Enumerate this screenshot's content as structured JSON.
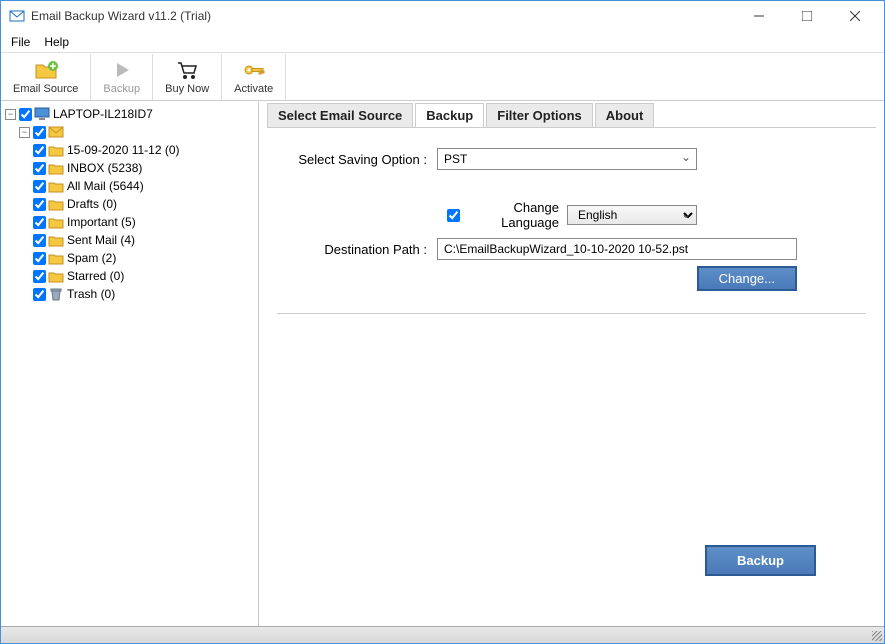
{
  "titlebar": {
    "title": "Email Backup Wizard v11.2 (Trial)"
  },
  "menu": {
    "file": "File",
    "help": "Help"
  },
  "toolbar": {
    "email_source": "Email Source",
    "backup": "Backup",
    "buy_now": "Buy Now",
    "activate": "Activate"
  },
  "tree": {
    "root": "LAPTOP-IL218ID7",
    "items": [
      "15-09-2020 11-12 (0)",
      "INBOX (5238)",
      "All Mail (5644)",
      "Drafts (0)",
      "Important (5)",
      "Sent Mail (4)",
      "Spam (2)",
      "Starred (0)",
      "Trash (0)"
    ]
  },
  "tabs": {
    "select_source": "Select Email Source",
    "backup": "Backup",
    "filter": "Filter Options",
    "about": "About"
  },
  "form": {
    "saving_option_label": "Select Saving Option :",
    "saving_option_value": "PST",
    "change_language_label": "Change Language",
    "language_value": "English",
    "destination_label": "Destination Path :",
    "destination_value": "C:\\EmailBackupWizard_10-10-2020 10-52.pst",
    "change_button": "Change...",
    "backup_button": "Backup"
  }
}
